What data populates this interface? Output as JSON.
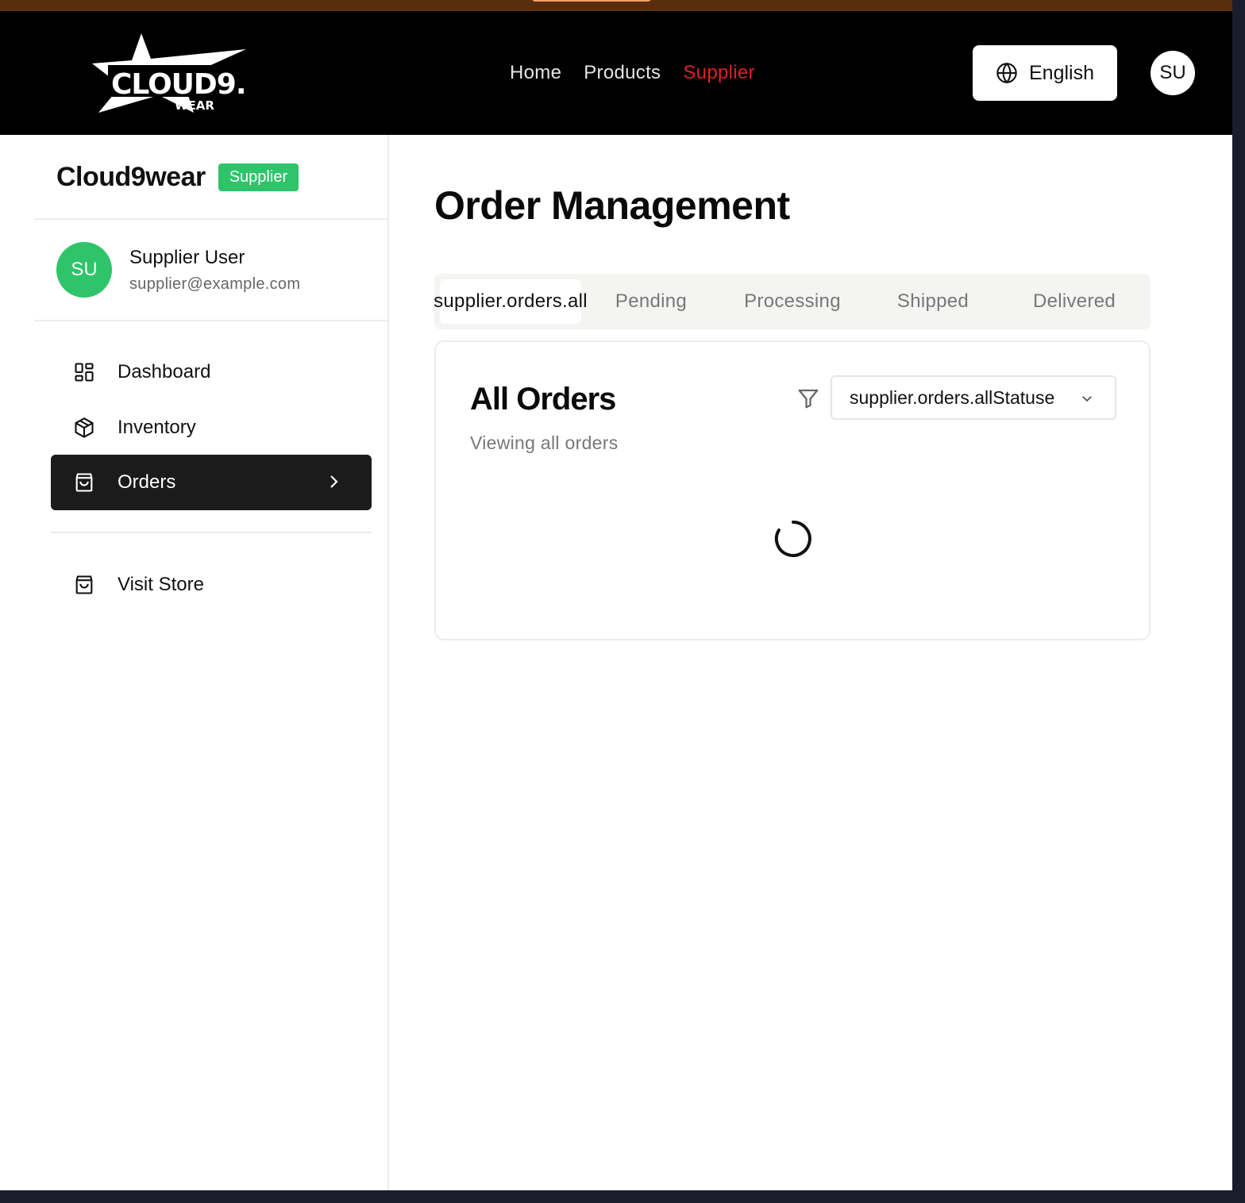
{
  "header": {
    "logo_text": "CLOUD9.",
    "logo_sub": "WEAR",
    "nav": [
      {
        "label": "Home"
      },
      {
        "label": "Products"
      },
      {
        "label": "Supplier"
      }
    ],
    "language": "English",
    "avatar_initials": "SU"
  },
  "sidebar": {
    "brand": "Cloud9wear",
    "role_badge": "Supplier",
    "user": {
      "initials": "SU",
      "name": "Supplier User",
      "email": "supplier@example.com"
    },
    "items": [
      {
        "label": "Dashboard",
        "icon": "dashboard-icon"
      },
      {
        "label": "Inventory",
        "icon": "package-icon"
      },
      {
        "label": "Orders",
        "icon": "shopping-bag-icon"
      }
    ],
    "visit_store": "Visit Store"
  },
  "main": {
    "title": "Order Management",
    "tabs": [
      {
        "label": "supplier.orders.all"
      },
      {
        "label": "Pending"
      },
      {
        "label": "Processing"
      },
      {
        "label": "Shipped"
      },
      {
        "label": "Delivered"
      }
    ],
    "card": {
      "title": "All Orders",
      "subtitle": "Viewing all orders",
      "status_filter": "supplier.orders.allStatuse"
    }
  },
  "colors": {
    "accent_red": "#e11d2a",
    "badge_green": "#2fc46a",
    "header_bg": "#000000",
    "active_nav_bg": "#1b1b1b"
  }
}
